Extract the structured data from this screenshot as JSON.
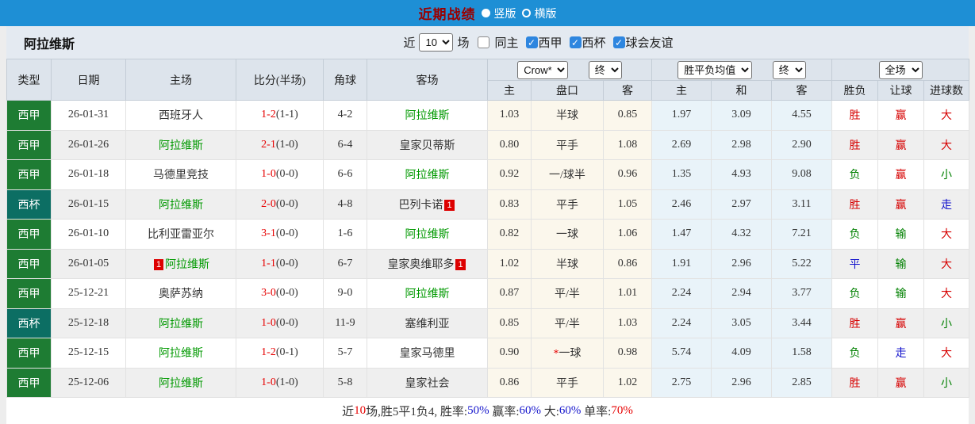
{
  "topbar": {
    "title": "近期战绩",
    "options": [
      {
        "label": "竖版",
        "selected": true
      },
      {
        "label": "横版",
        "selected": false
      }
    ]
  },
  "subbar": {
    "team": "阿拉维斯",
    "near_label": "近",
    "count": "10",
    "games_label": "场",
    "checkboxes": [
      {
        "label": "同主",
        "checked": false
      },
      {
        "label": "西甲",
        "checked": true
      },
      {
        "label": "西杯",
        "checked": true
      },
      {
        "label": "球会友谊",
        "checked": true
      }
    ]
  },
  "table": {
    "headers": {
      "left": [
        "类型",
        "日期",
        "主场",
        "比分(半场)",
        "角球",
        "客场"
      ],
      "odds_selects": [
        "Crow*",
        "终"
      ],
      "odds_cols": [
        "主",
        "盘口",
        "客"
      ],
      "avg_selects": [
        "胜平负均值",
        "终"
      ],
      "avg_cols": [
        "主",
        "和",
        "客"
      ],
      "result_select": "全场",
      "result_cols": [
        "胜负",
        "让球",
        "进球数"
      ]
    },
    "rows": [
      {
        "type": "西甲",
        "date": "26-01-31",
        "home": "西班牙人",
        "home_badge": "",
        "score_ft": "1-2",
        "score_ht": "(1-1)",
        "corner": "4-2",
        "away": "阿拉维斯",
        "away_badge": "",
        "odds_home": "1.03",
        "handicap_star": "",
        "handicap": "半球",
        "odds_away": "0.85",
        "avg_home": "1.97",
        "avg_draw": "3.09",
        "avg_away": "4.55",
        "result": "胜",
        "handicap_result": "赢",
        "goals_result": "大"
      },
      {
        "type": "西甲",
        "date": "26-01-26",
        "home": "阿拉维斯",
        "home_badge": "",
        "score_ft": "2-1",
        "score_ht": "(1-0)",
        "corner": "6-4",
        "away": "皇家贝蒂斯",
        "away_badge": "",
        "odds_home": "0.80",
        "handicap_star": "",
        "handicap": "平手",
        "odds_away": "1.08",
        "avg_home": "2.69",
        "avg_draw": "2.98",
        "avg_away": "2.90",
        "result": "胜",
        "handicap_result": "赢",
        "goals_result": "大"
      },
      {
        "type": "西甲",
        "date": "26-01-18",
        "home": "马德里竞技",
        "home_badge": "",
        "score_ft": "1-0",
        "score_ht": "(0-0)",
        "corner": "6-6",
        "away": "阿拉维斯",
        "away_badge": "",
        "odds_home": "0.92",
        "handicap_star": "",
        "handicap": "一/球半",
        "odds_away": "0.96",
        "avg_home": "1.35",
        "avg_draw": "4.93",
        "avg_away": "9.08",
        "result": "负",
        "handicap_result": "赢",
        "goals_result": "小"
      },
      {
        "type": "西杯",
        "date": "26-01-15",
        "home": "阿拉维斯",
        "home_badge": "",
        "score_ft": "2-0",
        "score_ht": "(0-0)",
        "corner": "4-8",
        "away": "巴列卡诺",
        "away_badge": "1",
        "odds_home": "0.83",
        "handicap_star": "",
        "handicap": "平手",
        "odds_away": "1.05",
        "avg_home": "2.46",
        "avg_draw": "2.97",
        "avg_away": "3.11",
        "result": "胜",
        "handicap_result": "赢",
        "goals_result": "走"
      },
      {
        "type": "西甲",
        "date": "26-01-10",
        "home": "比利亚雷亚尔",
        "home_badge": "",
        "score_ft": "3-1",
        "score_ht": "(0-0)",
        "corner": "1-6",
        "away": "阿拉维斯",
        "away_badge": "",
        "odds_home": "0.82",
        "handicap_star": "",
        "handicap": "一球",
        "odds_away": "1.06",
        "avg_home": "1.47",
        "avg_draw": "4.32",
        "avg_away": "7.21",
        "result": "负",
        "handicap_result": "输",
        "goals_result": "大"
      },
      {
        "type": "西甲",
        "date": "26-01-05",
        "home": "阿拉维斯",
        "home_badge": "1",
        "score_ft": "1-1",
        "score_ht": "(0-0)",
        "corner": "6-7",
        "away": "皇家奥维耶多",
        "away_badge": "1",
        "odds_home": "1.02",
        "handicap_star": "",
        "handicap": "半球",
        "odds_away": "0.86",
        "avg_home": "1.91",
        "avg_draw": "2.96",
        "avg_away": "5.22",
        "result": "平",
        "handicap_result": "输",
        "goals_result": "大"
      },
      {
        "type": "西甲",
        "date": "25-12-21",
        "home": "奥萨苏纳",
        "home_badge": "",
        "score_ft": "3-0",
        "score_ht": "(0-0)",
        "corner": "9-0",
        "away": "阿拉维斯",
        "away_badge": "",
        "odds_home": "0.87",
        "handicap_star": "",
        "handicap": "平/半",
        "odds_away": "1.01",
        "avg_home": "2.24",
        "avg_draw": "2.94",
        "avg_away": "3.77",
        "result": "负",
        "handicap_result": "输",
        "goals_result": "大"
      },
      {
        "type": "西杯",
        "date": "25-12-18",
        "home": "阿拉维斯",
        "home_badge": "",
        "score_ft": "1-0",
        "score_ht": "(0-0)",
        "corner": "11-9",
        "away": "塞维利亚",
        "away_badge": "",
        "odds_home": "0.85",
        "handicap_star": "",
        "handicap": "平/半",
        "odds_away": "1.03",
        "avg_home": "2.24",
        "avg_draw": "3.05",
        "avg_away": "3.44",
        "result": "胜",
        "handicap_result": "赢",
        "goals_result": "小"
      },
      {
        "type": "西甲",
        "date": "25-12-15",
        "home": "阿拉维斯",
        "home_badge": "",
        "score_ft": "1-2",
        "score_ht": "(0-1)",
        "corner": "5-7",
        "away": "皇家马德里",
        "away_badge": "",
        "odds_home": "0.90",
        "handicap_star": "*",
        "handicap": "一球",
        "odds_away": "0.98",
        "avg_home": "5.74",
        "avg_draw": "4.09",
        "avg_away": "1.58",
        "result": "负",
        "handicap_result": "走",
        "goals_result": "大"
      },
      {
        "type": "西甲",
        "date": "25-12-06",
        "home": "阿拉维斯",
        "home_badge": "",
        "score_ft": "1-0",
        "score_ht": "(1-0)",
        "corner": "5-8",
        "away": "皇家社会",
        "away_badge": "",
        "odds_home": "0.86",
        "handicap_star": "",
        "handicap": "平手",
        "odds_away": "1.02",
        "avg_home": "2.75",
        "avg_draw": "2.96",
        "avg_away": "2.85",
        "result": "胜",
        "handicap_result": "赢",
        "goals_result": "小"
      }
    ]
  },
  "footer": {
    "segments": [
      {
        "text": "近",
        "color": "#333333"
      },
      {
        "text": "10",
        "color": "#e60000"
      },
      {
        "text": "场,胜5平1负4, 胜率:",
        "color": "#333333"
      },
      {
        "text": "50%",
        "color": "#1515cc"
      },
      {
        "text": " 赢率:",
        "color": "#333333"
      },
      {
        "text": "60%",
        "color": "#1515cc"
      },
      {
        "text": " 大:",
        "color": "#333333"
      },
      {
        "text": "60%",
        "color": "#1515cc"
      },
      {
        "text": " 单率:",
        "color": "#333333"
      },
      {
        "text": "70%",
        "color": "#e60000"
      }
    ]
  },
  "colors": {
    "topbar_bg": "#1e8fd5",
    "title_text": "#990000",
    "league_primary": "#1e7c33",
    "league_cup": "#0c6e63",
    "self_team": "#009900",
    "win_red": "#d60000",
    "lose_green": "#008000",
    "draw_blue": "#1515cc"
  }
}
